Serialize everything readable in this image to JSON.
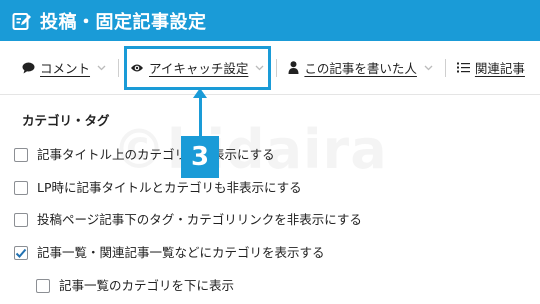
{
  "header": {
    "title": "投稿・固定記事設定",
    "icon": "edit-note-icon",
    "bg_color": "#1a9bd7"
  },
  "tabs": [
    {
      "label": "コメント",
      "icon": "speech-bubble-icon"
    },
    {
      "label": "アイキャッチ設定",
      "icon": "eye-icon"
    },
    {
      "label": "この記事を書いた人",
      "icon": "user-icon"
    },
    {
      "label": "関連記事",
      "icon": "list-icon"
    }
  ],
  "annotation": {
    "step_number": "3",
    "color": "#1a9bd7"
  },
  "watermark": "©hidaira",
  "section": {
    "title": "カテゴリ・タグ"
  },
  "options": [
    {
      "label": "記事タイトル上のカテゴリを非表示にする",
      "checked": false
    },
    {
      "label": "LP時に記事タイトルとカテゴリも非表示にする",
      "checked": false
    },
    {
      "label": "投稿ページ記事下のタグ・カテゴリリンクを非表示にする",
      "checked": false
    },
    {
      "label": "記事一覧・関連記事一覧などにカテゴリを表示する",
      "checked": true
    },
    {
      "label": "記事一覧のカテゴリを下に表示",
      "checked": false
    }
  ]
}
